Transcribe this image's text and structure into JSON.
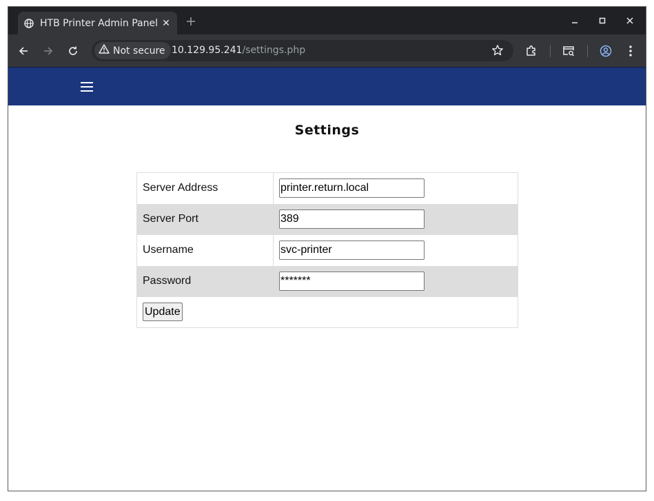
{
  "browser": {
    "tab_title": "HTB Printer Admin Panel",
    "tab_close": "✕",
    "security_label": "Not secure",
    "url_host": "10.129.95.241",
    "url_path": "/settings.php"
  },
  "page": {
    "title": "Settings"
  },
  "settings": {
    "rows": [
      {
        "label": "Server Address",
        "value": "printer.return.local"
      },
      {
        "label": "Server Port",
        "value": "389"
      },
      {
        "label": "Username",
        "value": "svc-printer"
      },
      {
        "label": "Password",
        "value": "*******"
      }
    ],
    "update_label": "Update"
  },
  "colors": {
    "header": "#1b367d",
    "row_shade": "#dddddd",
    "browser_frame": "#202124",
    "browser_toolbar": "#35363a"
  }
}
